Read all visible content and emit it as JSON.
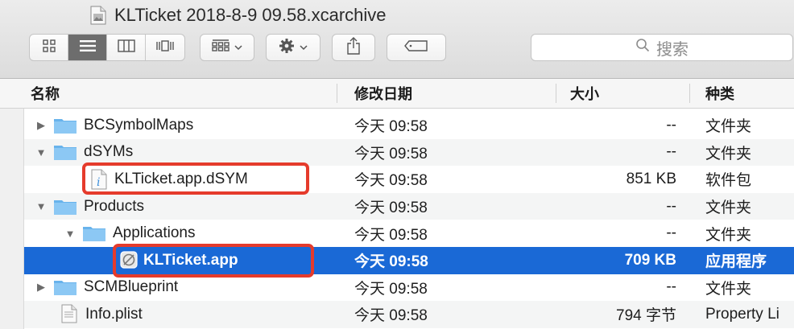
{
  "window": {
    "title": "KLTicket 2018-8-9 09.58.xcarchive"
  },
  "toolbar": {
    "search_placeholder": "搜索"
  },
  "columns": {
    "name": "名称",
    "date": "修改日期",
    "size": "大小",
    "kind": "种类"
  },
  "rows": [
    {
      "name": "BCSymbolMaps",
      "date": "今天 09:58",
      "size": "--",
      "kind": "文件夹",
      "expanded": false
    },
    {
      "name": "dSYMs",
      "date": "今天 09:58",
      "size": "--",
      "kind": "文件夹",
      "expanded": true
    },
    {
      "name": "KLTicket.app.dSYM",
      "date": "今天 09:58",
      "size": "851 KB",
      "kind": "软件包"
    },
    {
      "name": "Products",
      "date": "今天 09:58",
      "size": "--",
      "kind": "文件夹",
      "expanded": true
    },
    {
      "name": "Applications",
      "date": "今天 09:58",
      "size": "--",
      "kind": "文件夹",
      "expanded": true
    },
    {
      "name": "KLTicket.app",
      "date": "今天 09:58",
      "size": "709 KB",
      "kind": "应用程序",
      "selected": true
    },
    {
      "name": "SCMBlueprint",
      "date": "今天 09:58",
      "size": "--",
      "kind": "文件夹",
      "expanded": false
    },
    {
      "name": "Info.plist",
      "date": "今天 09:58",
      "size": "794 字节",
      "kind": "Property Li"
    }
  ],
  "colors": {
    "selection": "#1a69d6",
    "folder": "#6cb7ef",
    "annotation": "#e53b2c"
  }
}
